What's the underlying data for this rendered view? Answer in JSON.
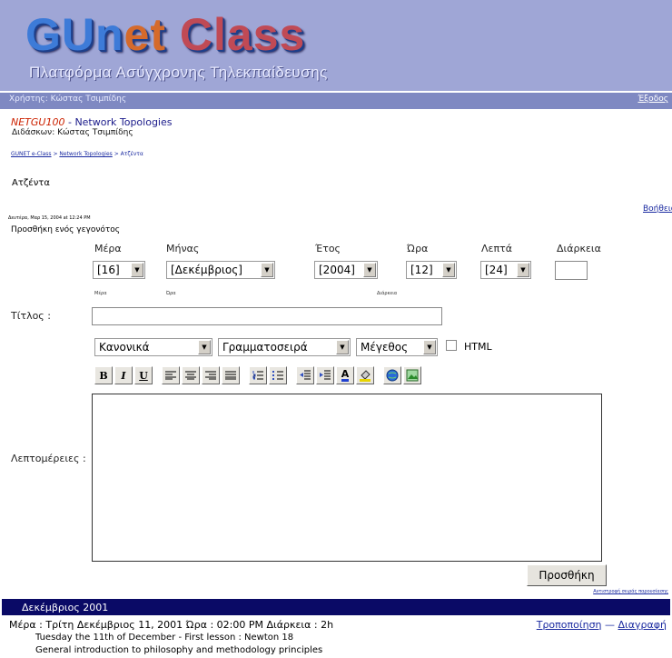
{
  "banner": {
    "logo_part1": "GUn",
    "logo_e": "e",
    "logo_t": "t ",
    "logo_class": "Class",
    "subtitle": "Πλατφόρμα Ασύγχρονης Τηλεκπαίδευσης"
  },
  "userbar": {
    "user": "Χρήστης: Κώστας Τσιμπίδης",
    "logout": "Έξοδος"
  },
  "course": {
    "code": "NETGU100",
    "separator": " - ",
    "name": "Network Topologies",
    "teacher": "Διδάσκων: Κώστας Τσιμπίδης"
  },
  "breadcrumb": {
    "home": "GUNET e-Class",
    "sep1": " > ",
    "course": "Network Topologies",
    "sep2": " > ",
    "current": "Ατζέντα"
  },
  "page": {
    "title": "Ατζέντα",
    "help": "Βοήθεια",
    "date_stamp": "Δευτέρα, Μαρ 15, 2004 at 12:24 PM",
    "add_event": "Προσθήκη ενός γεγονότος"
  },
  "form": {
    "labels": {
      "day": "Μέρα",
      "month": "Μήνας",
      "year": "Έτος",
      "hour": "Ώρα",
      "minute": "Λεπτά",
      "duration": "Διάρκεια",
      "title": "Τίτλος :",
      "details": "Λεπτομέρειες :"
    },
    "values": {
      "day": "[16]",
      "month": "[Δεκέμβριος]",
      "year": "[2004]",
      "hour": "[12]",
      "minute": "[24]",
      "duration": "",
      "title": ""
    },
    "hints": {
      "day": "Μέρα",
      "time": "Ώρα",
      "duration": "Διάρκεια"
    },
    "editor": {
      "format": "Κανονικά",
      "font": "Γραμματοσειρά",
      "size": "Μέγεθος",
      "html_label": "HTML"
    },
    "toolbar": {
      "bold": "B",
      "italic": "I",
      "underline": "U",
      "font_color": "A"
    },
    "submit": "Προσθήκη"
  },
  "order_link": "Αντιστροφή σειράς παρουσίασης",
  "events": {
    "month_header": "Δεκέμβριος 2001",
    "items": [
      {
        "info": "Μέρα : Τρίτη Δεκέμβριος 11, 2001  Ώρα : 02:00 PM  Διάρκεια : 2h",
        "edit": "Τροποποίηση",
        "dash": " — ",
        "delete": "Διαγραφή",
        "title": "Tuesday the 11th of December - First lesson : Newton 18",
        "description": "General introduction to philosophy and methodology principles"
      }
    ]
  },
  "colors": {
    "banner": "#9fa6d6",
    "userbar": "#7f89c2",
    "month_bar": "#0a0a66",
    "link": "#1a2aa0"
  }
}
